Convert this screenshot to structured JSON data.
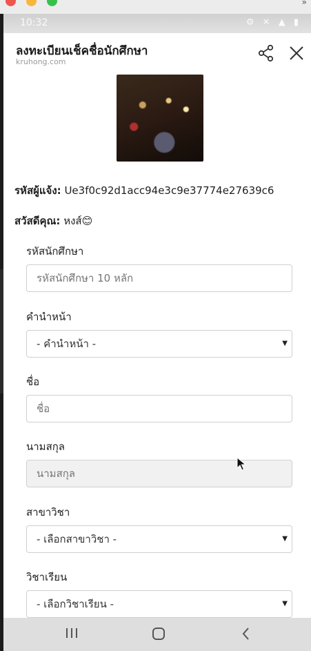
{
  "status": {
    "time": "10:32"
  },
  "header": {
    "title": "ลงทะเบียนเช็คชื่อนักศึกษา",
    "subtitle": "kruhong.com"
  },
  "info": {
    "id_label": "รหัสผู้แจ้ง:",
    "id_value": "Ue3f0c92d1acc94e3c9e37774e27639c6",
    "greeting_label": "สวัสดีคุณ:",
    "greeting_value": "หงส์😊"
  },
  "form": {
    "student_id": {
      "label": "รหัสนักศึกษา",
      "placeholder": "รหัสนักศึกษา 10 หลัก"
    },
    "prefix": {
      "label": "คำนำหน้า",
      "selected": "- คำนำหน้า -"
    },
    "first_name": {
      "label": "ชื่อ",
      "placeholder": "ชื่อ"
    },
    "last_name": {
      "label": "นามสกุล",
      "placeholder": "นามสกุล"
    },
    "major": {
      "label": "สาขาวิชา",
      "selected": "- เลือกสาขาวิชา -"
    },
    "course": {
      "label": "วิชาเรียน",
      "selected": "- เลือกวิชาเรียน -"
    }
  },
  "icons": {
    "share": "share-icon",
    "close": "close-icon",
    "recent": "recent-apps-icon",
    "home": "home-icon",
    "back": "back-icon"
  }
}
